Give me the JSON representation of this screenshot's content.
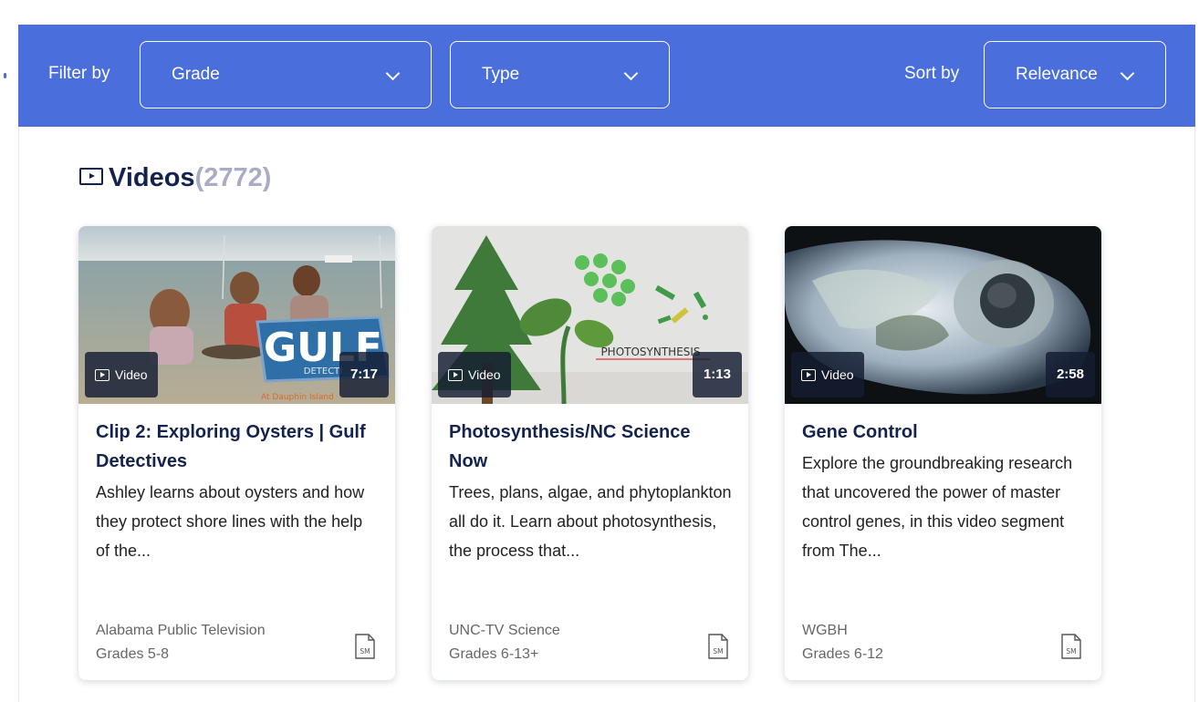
{
  "filter_bar": {
    "filter_label": "Filter by",
    "grade_select": "Grade",
    "type_select": "Type",
    "sort_label": "Sort by",
    "sort_select": "Relevance"
  },
  "section": {
    "title": "Videos",
    "count": "(2772)"
  },
  "cards": [
    {
      "badge": "Video",
      "duration": "7:17",
      "title": "Clip 2: Exploring Oysters | Gulf Detectives",
      "description": "Ashley learns about oysters and how they protect shore lines with the help of the...",
      "source": "Alabama Public Television",
      "grades": "Grades 5-8",
      "thumb_text": "GULF",
      "thumb_subtext": "DETECTI",
      "thumb_caption": "At Dauphin Island"
    },
    {
      "badge": "Video",
      "duration": "1:13",
      "title": "Photosynthesis/NC Science Now",
      "description": "Trees, plans, algae, and phytoplankton all do it. Learn about photosynthesis, the process that...",
      "source": "UNC-TV Science",
      "grades": "Grades 6-13+",
      "thumb_text": "PHOTOSYNTHESIS"
    },
    {
      "badge": "Video",
      "duration": "2:58",
      "title": "Gene Control",
      "description": "Explore the groundbreaking research that uncovered the power of master control genes, in this video segment from The...",
      "source": "WGBH",
      "grades": "Grades 6-12"
    }
  ],
  "icons": {
    "media_type_icon": "SM"
  },
  "colors": {
    "filter_bar": "#4a6edb",
    "title_navy": "#14224f",
    "count_gray": "#a8acc4"
  }
}
